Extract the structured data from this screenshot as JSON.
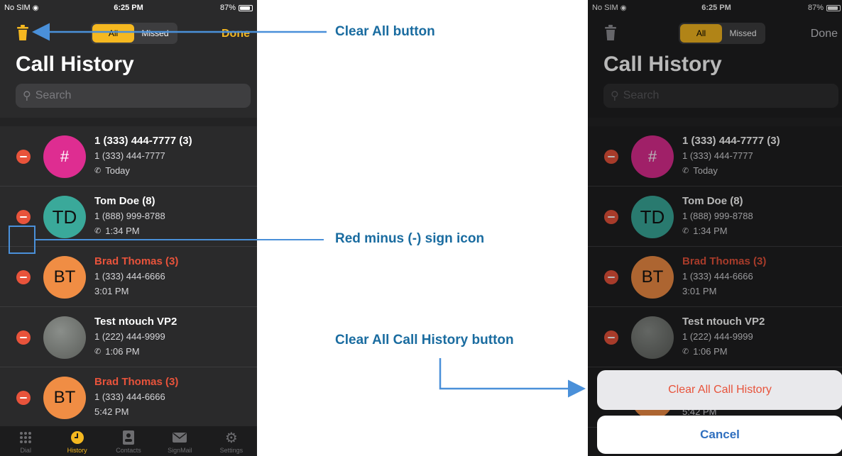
{
  "status": {
    "carrier": "No SIM",
    "time": "6:25 PM",
    "battery": "87%"
  },
  "header": {
    "segments": [
      "All",
      "Missed"
    ],
    "done_label": "Done",
    "title": "Call History",
    "search_placeholder": "Search"
  },
  "rows": [
    {
      "name": "1 (333) 444-7777 (3)",
      "number": "1 (333) 444-7777",
      "time": "Today",
      "avatar": "#",
      "avatar_color": "#de2d91",
      "missed": false,
      "icon": "call-icon"
    },
    {
      "name": "Tom Doe (8)",
      "number": "1 (888) 999-8788",
      "time": "1:34 PM",
      "avatar": "TD",
      "avatar_color": "#3aa99a",
      "missed": false,
      "icon": "call-icon"
    },
    {
      "name": "Brad Thomas (3)",
      "number": "1 (333) 444-6666",
      "time": "3:01 PM",
      "avatar": "BT",
      "avatar_color": "#f08d44",
      "missed": true,
      "icon": ""
    },
    {
      "name": "Test ntouch VP2",
      "number": "1 (222) 444-9999",
      "time": "1:06 PM",
      "avatar": "",
      "avatar_color": "#6f726e",
      "missed": false,
      "icon": "call-icon"
    },
    {
      "name": "Brad Thomas (3)",
      "number": "1 (333) 444-6666",
      "time": "5:42 PM",
      "avatar": "BT",
      "avatar_color": "#f08d44",
      "missed": true,
      "icon": ""
    }
  ],
  "tabs": [
    {
      "label": "Dial",
      "icon": "keypad-icon"
    },
    {
      "label": "History",
      "icon": "clock-icon"
    },
    {
      "label": "Contacts",
      "icon": "contacts-icon"
    },
    {
      "label": "SignMail",
      "icon": "mail-icon"
    },
    {
      "label": "Settings",
      "icon": "gear-icon"
    }
  ],
  "action_sheet": {
    "clear_all": "Clear All Call History",
    "cancel": "Cancel"
  },
  "callouts": {
    "clear_all_button": "Clear All button",
    "red_minus": "Red minus (-) sign icon",
    "clear_all_history": "Clear All Call History button"
  },
  "colors": {
    "accent": "#f5b820",
    "delete": "#e8533b",
    "callout_text": "#1a6ca0",
    "arrow": "#4a90d9"
  }
}
